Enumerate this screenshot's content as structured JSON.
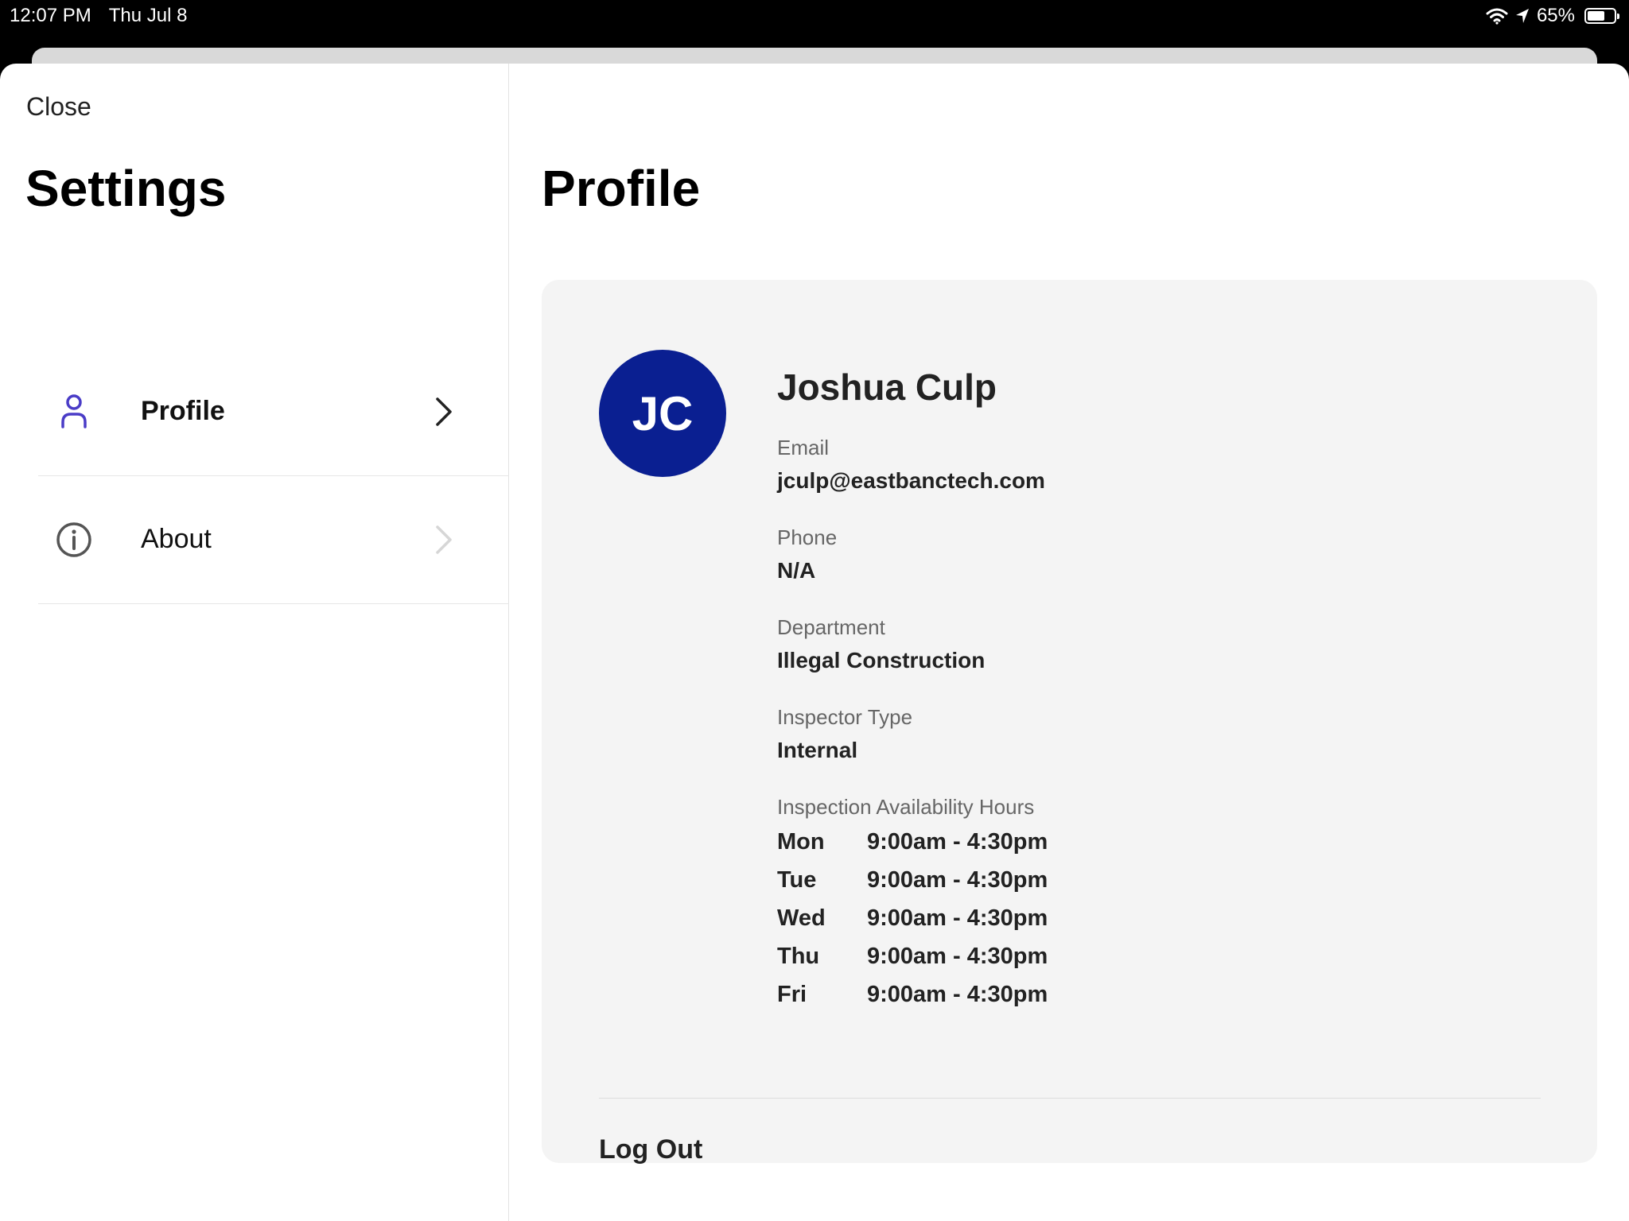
{
  "status_bar": {
    "time": "12:07 PM",
    "date": "Thu Jul 8",
    "battery": "65%",
    "battery_level": 0.65
  },
  "sidebar": {
    "close_label": "Close",
    "title": "Settings",
    "items": [
      {
        "label": "Profile",
        "icon": "person-icon",
        "selected": true
      },
      {
        "label": "About",
        "icon": "info-icon",
        "selected": false
      }
    ]
  },
  "main": {
    "title": "Profile",
    "profile": {
      "initials": "JC",
      "avatar_color": "#0a1f91",
      "name": "Joshua Culp",
      "fields": [
        {
          "label": "Email",
          "value": "jculp@eastbanctech.com"
        },
        {
          "label": "Phone",
          "value": "N/A"
        },
        {
          "label": "Department",
          "value": "Illegal Construction"
        },
        {
          "label": "Inspector Type",
          "value": "Internal"
        }
      ],
      "hours_label": "Inspection Availability Hours",
      "hours": [
        {
          "day": "Mon",
          "time": "9:00am - 4:30pm"
        },
        {
          "day": "Tue",
          "time": "9:00am - 4:30pm"
        },
        {
          "day": "Wed",
          "time": "9:00am - 4:30pm"
        },
        {
          "day": "Thu",
          "time": "9:00am - 4:30pm"
        },
        {
          "day": "Fri",
          "time": "9:00am - 4:30pm"
        }
      ]
    },
    "logout_label": "Log Out"
  },
  "colors": {
    "accent": "#4a3cc7",
    "card_bg": "#f4f4f4"
  }
}
